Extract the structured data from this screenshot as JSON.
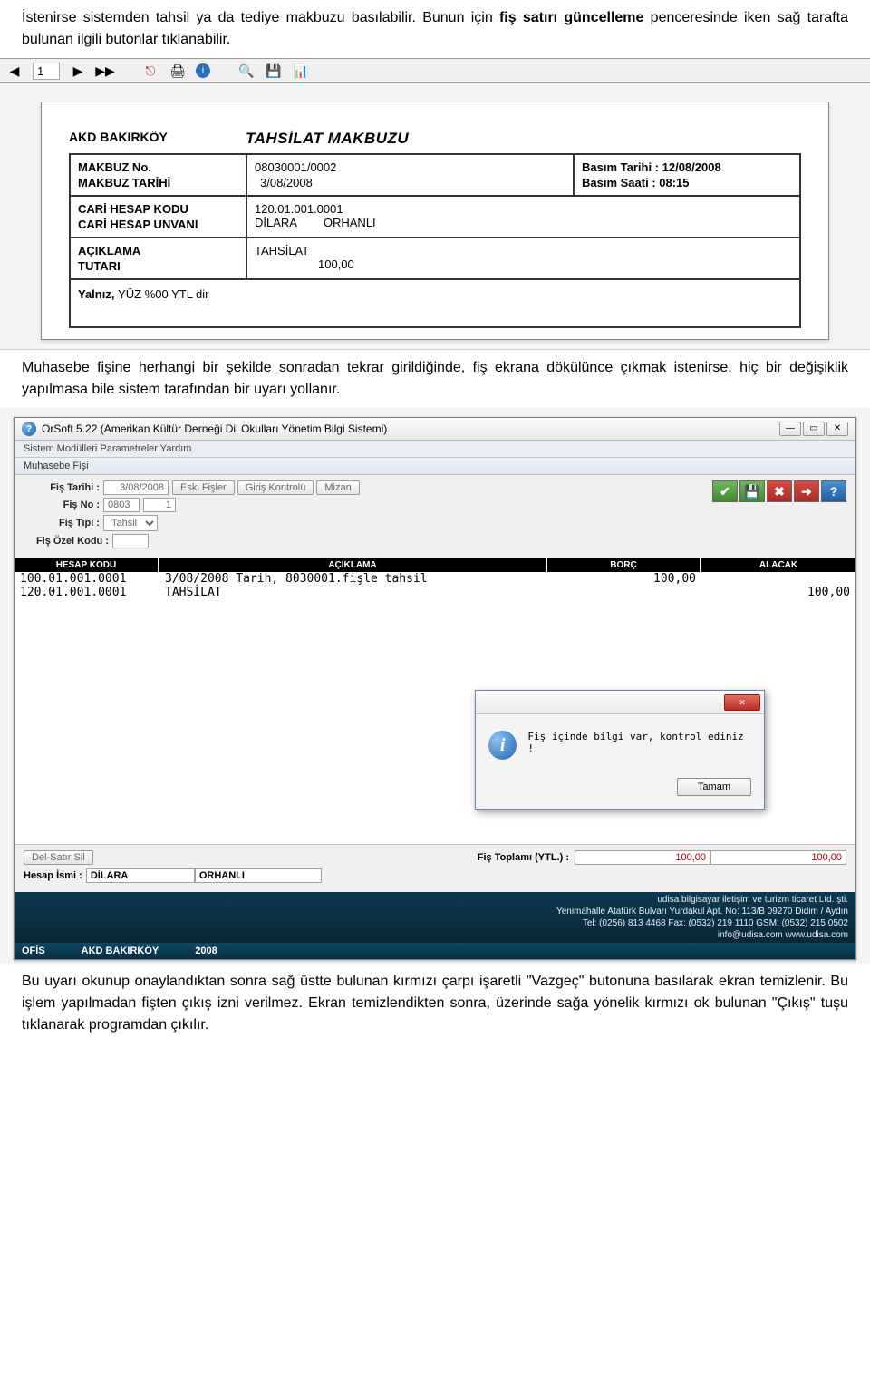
{
  "intro": {
    "p1_a": "İstenirse sistemden tahsil ya da tediye makbuzu basılabilir. Bunun için ",
    "p1_bold": "fiş satırı güncelleme",
    "p1_b": " penceresinde iken sağ tarafta bulunan ilgili butonlar tıklanabilir."
  },
  "preview_toolbar": {
    "page": "1"
  },
  "receipt": {
    "company": "AKD BAKIRKÖY",
    "title": "TAHSİLAT MAKBUZU",
    "makbuz_no_lbl": "MAKBUZ No.",
    "makbuz_no": "08030001/0002",
    "makbuz_tarih_lbl": "MAKBUZ TARİHİ",
    "makbuz_tarih": "3/08/2008",
    "basim_tarih_lbl": "Basım Tarihi : ",
    "basim_tarih": "12/08/2008",
    "basim_saat_lbl": "Basım Saati  : ",
    "basim_saat": "08:15",
    "cari_kod_lbl": "CARİ HESAP KODU",
    "cari_kod": "120.01.001.0001",
    "cari_unvan_lbl": "CARİ HESAP UNVANI",
    "cari_unvan_a": "DİLARA",
    "cari_unvan_b": "ORHANLI",
    "aciklama_lbl": "AÇIKLAMA",
    "aciklama": "TAHSİLAT",
    "tutar_lbl": "TUTARI",
    "tutar": "100,00",
    "yalniz_lbl": "Yalnız, ",
    "yalniz": "YÜZ %00 YTL dir"
  },
  "mid_para": "Muhasebe fişine herhangi bir şekilde sonradan tekrar girildiğinde, fiş ekrana dökülünce çıkmak istenirse, hiç bir değişiklik yapılmasa bile sistem tarafından bir uyarı yollanır.",
  "app": {
    "title": "OrSoft 5.22 (Amerikan Kültür Derneği Dil Okulları Yönetim Bilgi Sistemi)",
    "menubar": "Sistem Modülleri   Parametreler   Yardım",
    "inner_title": "Muhasebe Fişi",
    "form": {
      "fis_tarihi_lbl": "Fiş Tarihi :",
      "fis_tarihi": "3/08/2008",
      "eski_fisler": "Eski Fişler",
      "giris_kontrolu": "Giriş Kontrolü",
      "mizan": "Mizan",
      "fis_no_lbl": "Fiş No :",
      "fis_no_a": "0803",
      "fis_no_b": "1",
      "fis_tipi_lbl": "Fiş Tipi :",
      "fis_tipi": "Tahsil",
      "fis_ozel_lbl": "Fiş Özel Kodu :",
      "fis_ozel": ""
    },
    "grid": {
      "h1": "HESAP KODU",
      "h2": "AÇIKLAMA",
      "h3": "BORÇ",
      "h4": "ALACAK",
      "rows": [
        {
          "kod": "100.01.001.0001",
          "acik": "3/08/2008 Tarih, 8030001.fişle tahsil",
          "borc": "100,00",
          "alacak": ""
        },
        {
          "kod": "120.01.001.0001",
          "acik": "TAHSİLAT",
          "borc": "",
          "alacak": "100,00"
        }
      ]
    },
    "dialog": {
      "msg": "Fiş içinde bilgi var, kontrol ediniz !",
      "ok": "Tamam"
    },
    "bottom": {
      "del_satir": "Del-Satır Sil",
      "fis_toplam_lbl": "Fiş Toplamı (YTL.) :",
      "t1": "100,00",
      "t2": "100,00",
      "hesap_ismi_lbl": "Hesap İsmi :",
      "hesap_ismi_a": "DİLARA",
      "hesap_ismi_b": "ORHANLI"
    },
    "status_strip": {
      "l1": "udisa bilgisayar iletişim ve turizm ticaret Ltd. şti.",
      "l2": "Yenimahalle Atatürk Bulvarı Yurdakul Apt. No: 113/B 09270 Didim / Aydın",
      "l3": "Tel: (0256) 813 4468 Fax: (0532) 219 1110 GSM: (0532) 215 0502",
      "l4": "info@udisa.com   www.udisa.com"
    },
    "statusbar": {
      "a": "OFİS",
      "b": "AKD BAKIRKÖY",
      "c": "2008"
    }
  },
  "outro": "Bu uyarı okunup onaylandıktan sonra sağ üstte bulunan kırmızı çarpı işaretli \"Vazgeç\" butonuna basılarak ekran temizlenir. Bu işlem yapılmadan fişten çıkış izni verilmez. Ekran temizlendikten sonra, üzerinde sağa yönelik kırmızı ok bulunan \"Çıkış\" tuşu tıklanarak programdan çıkılır."
}
